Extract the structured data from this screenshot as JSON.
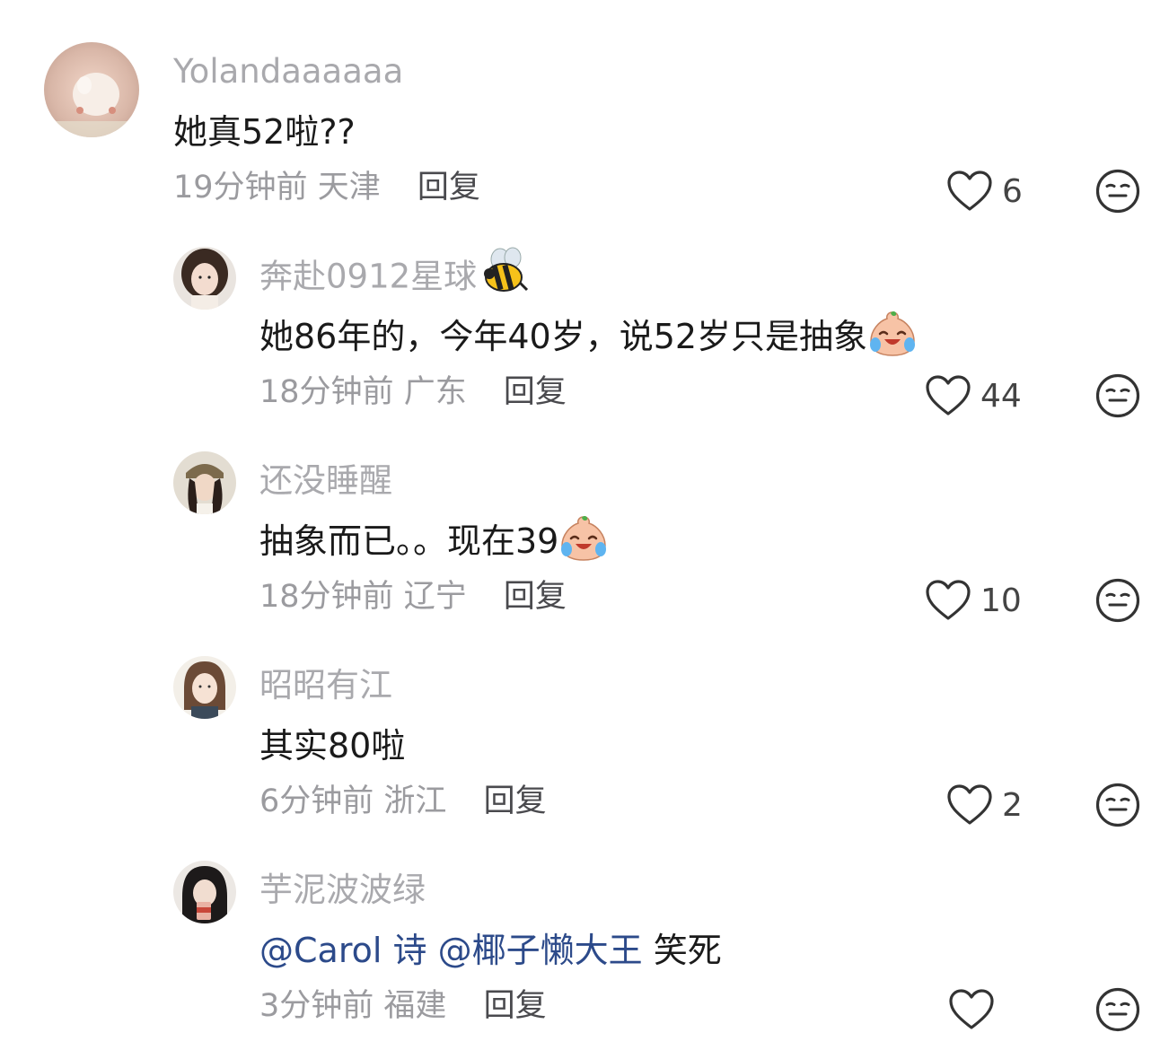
{
  "comments": [
    {
      "username": "Yolandaaaaaa",
      "text": "她真52啦??",
      "time": "19分钟前",
      "location": "天津",
      "reply_label": "回复",
      "likes": "6"
    },
    {
      "username": "奔赴0912星球",
      "username_emoji": "bee-emoji",
      "text": "她86年的，今年40岁，说52岁只是抽象",
      "text_emoji": "laughing-crying-emoji",
      "time": "18分钟前",
      "location": "广东",
      "reply_label": "回复",
      "likes": "44"
    },
    {
      "username": "还没睡醒",
      "text": "抽象而已。。现在39",
      "text_emoji": "laughing-crying-emoji",
      "time": "18分钟前",
      "location": "辽宁",
      "reply_label": "回复",
      "likes": "10"
    },
    {
      "username": "昭昭有江",
      "text": "其实80啦",
      "time": "6分钟前",
      "location": "浙江",
      "reply_label": "回复",
      "likes": "2"
    },
    {
      "username": "芋泥波波绿",
      "mention1": "@Carol 诗",
      "mention2": "@椰子懒大王",
      "text": "笑死",
      "time": "3分钟前",
      "location": "福建",
      "reply_label": "回复",
      "likes": ""
    }
  ],
  "icons": {
    "like": "heart-outline-icon",
    "dislike": "meh-face-icon"
  },
  "colors": {
    "username": "#a9a9ad",
    "mention": "#2c4a8a",
    "meta": "#9b9b9f"
  }
}
